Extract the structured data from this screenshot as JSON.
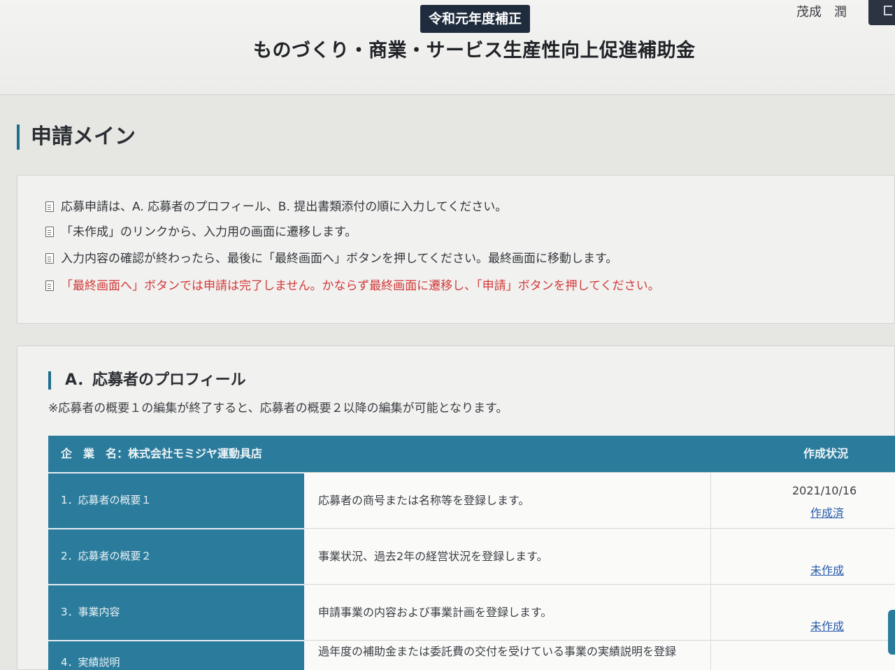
{
  "header": {
    "fiscal_badge": "令和元年度補正",
    "site_title": "ものづくり・商業・サービス生産性向上促進補助金",
    "user_name": "茂成　潤"
  },
  "page": {
    "heading": "申請メイン"
  },
  "notices": [
    {
      "text": "応募申請は、A. 応募者のプロフィール、B. 提出書類添付の順に入力してください。",
      "warn": false
    },
    {
      "text": "「未作成」のリンクから、入力用の画面に遷移します。",
      "warn": false
    },
    {
      "text": "入力内容の確認が終わったら、最後に「最終画面へ」ボタンを押してください。最終画面に移動します。",
      "warn": false
    },
    {
      "text": "「最終画面へ」ボタンでは申請は完了しません。かならず最終画面に遷移し、「申請」ボタンを押してください。",
      "warn": true
    }
  ],
  "profile": {
    "heading": "A．応募者のプロフィール",
    "note": "※応募者の概要１の編集が終了すると、応募者の概要２以降の編集が可能となります。",
    "table": {
      "company_label": "企　業　名：株式会社モミジヤ運動具店",
      "status_header": "作成状況",
      "rows": [
        {
          "label": "1．応募者の概要１",
          "description": "応募者の商号または名称等を登録します。",
          "date": "2021/10/16",
          "status": "作成済"
        },
        {
          "label": "2．応募者の概要２",
          "description": "事業状況、過去2年の経営状況を登録します。",
          "date": "",
          "status": "未作成"
        },
        {
          "label": "3．事業内容",
          "description": "申請事業の内容および事業計画を登録します。",
          "date": "",
          "status": "未作成"
        },
        {
          "label": "4．実績説明",
          "description": "過年度の補助金または委託費の交付を受けている事業の実績説明を登録",
          "date": "",
          "status": ""
        }
      ]
    }
  },
  "colors": {
    "accent": "#2b7c9c",
    "badge_bg": "#1e2c3d",
    "warning_text": "#d23a3a",
    "link": "#2a5caa"
  }
}
